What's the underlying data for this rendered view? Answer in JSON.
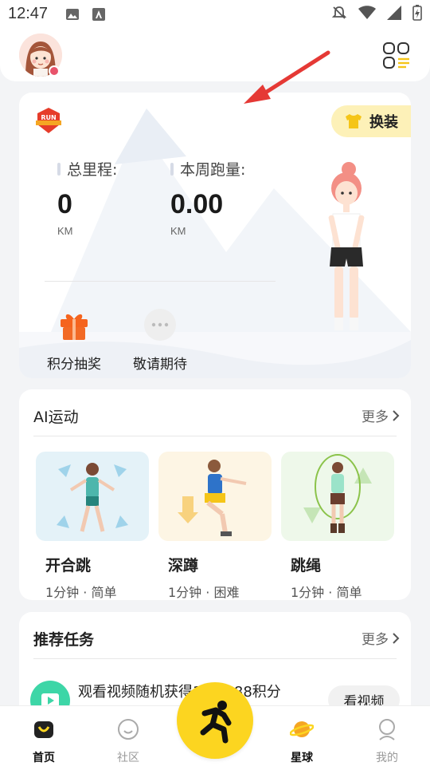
{
  "status_bar": {
    "time": "12:47"
  },
  "header": {
    "avatar_icon": "avatar-girl",
    "menu_icon": "grid-menu-icon"
  },
  "run_card": {
    "outfit_label": "换装",
    "total_distance": {
      "label": "总里程:",
      "value": "0",
      "unit": "KM"
    },
    "week_distance": {
      "label": "本周跑量:",
      "value": "0.00",
      "unit": "KM"
    },
    "actions": [
      {
        "label": "积分抽奖",
        "icon": "gift-icon"
      },
      {
        "label": "敬请期待",
        "icon": "more-dots-icon"
      }
    ]
  },
  "ai_section": {
    "title": "AI运动",
    "more_label": "更多",
    "exercises": [
      {
        "name": "开合跳",
        "meta": "1分钟 · 简单"
      },
      {
        "name": "深蹲",
        "meta": "1分钟 · 困难"
      },
      {
        "name": "跳绳",
        "meta": "1分钟 · 简单"
      }
    ]
  },
  "task_section": {
    "title": "推荐任务",
    "more_label": "更多",
    "task_text": "观看视频随机获得188/388积分",
    "task_button": "看视频"
  },
  "bottom_nav": {
    "items": [
      {
        "label": "首页"
      },
      {
        "label": "社区"
      },
      {
        "label": "星球"
      },
      {
        "label": "我的"
      }
    ]
  },
  "colors": {
    "accent_yellow": "#fcd520",
    "outfit_bg": "#fdf1b8",
    "gift_orange": "#f5641e",
    "task_green": "#3dd6a7"
  }
}
